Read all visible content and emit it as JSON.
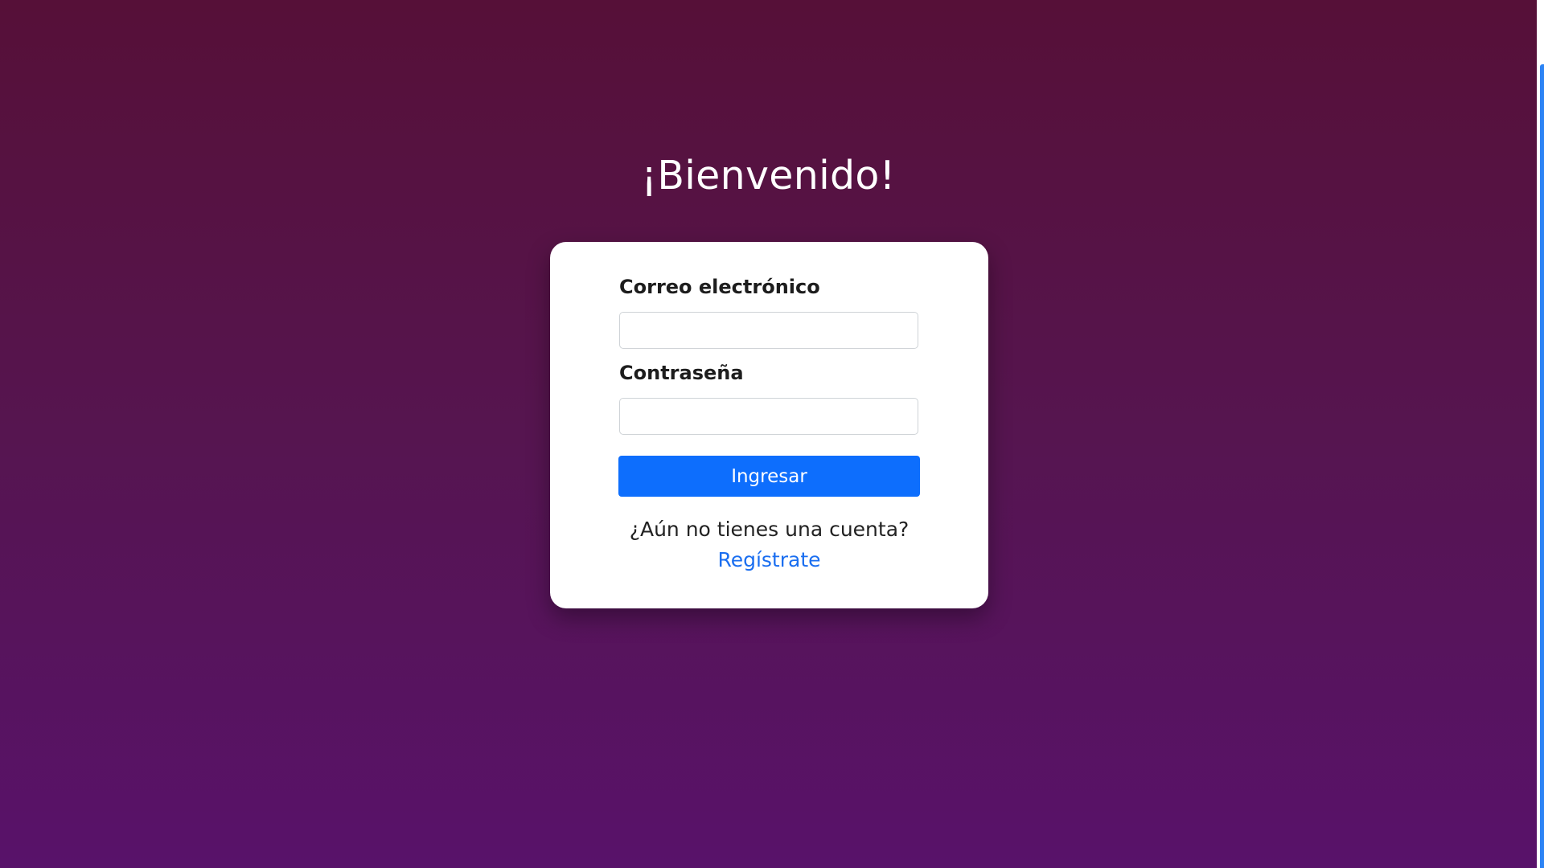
{
  "page": {
    "title": "¡Bienvenido!"
  },
  "form": {
    "email_label": "Correo electrónico",
    "email_value": "",
    "password_label": "Contraseña",
    "password_value": "",
    "submit_label": "Ingresar",
    "signup_prompt": "¿Aún no tienes una cuenta?",
    "signup_link": "Regístrate"
  },
  "colors": {
    "background_top": "#561038",
    "background_bottom": "#58126a",
    "primary_button": "#0d6efd",
    "link": "#1a6ef0",
    "card": "#ffffff"
  }
}
